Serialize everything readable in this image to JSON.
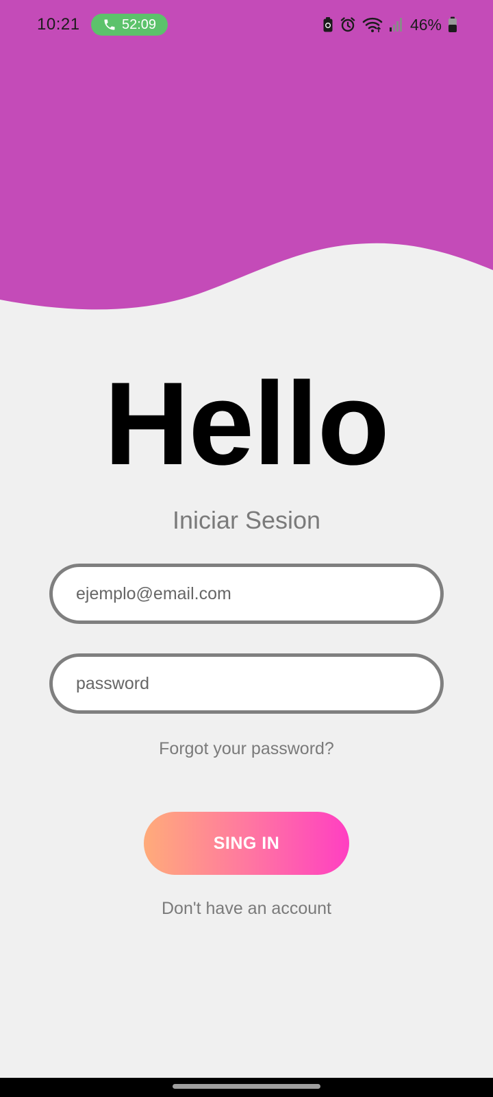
{
  "status_bar": {
    "time": "10:21",
    "call_timer": "52:09",
    "battery_percent": "46%",
    "icons": [
      "phone-icon",
      "battery-saver-icon",
      "alarm-icon",
      "wifi-icon",
      "signal-icon",
      "battery-icon"
    ]
  },
  "colors": {
    "header": "#c44bb8",
    "background": "#f0f0f0",
    "call_pill": "#5cc26b",
    "button_gradient_start": "#ffab7a",
    "button_gradient_end": "#ff3fc2",
    "field_border": "#7f7f7f",
    "muted_text": "#7a7a7a"
  },
  "login": {
    "title": "Hello",
    "subtitle": "Iniciar Sesion",
    "email_placeholder": "ejemplo@email.com",
    "password_placeholder": "password",
    "forgot_password": "Forgot your password?",
    "sign_in_label": "SING IN",
    "no_account": "Don't have an account"
  }
}
